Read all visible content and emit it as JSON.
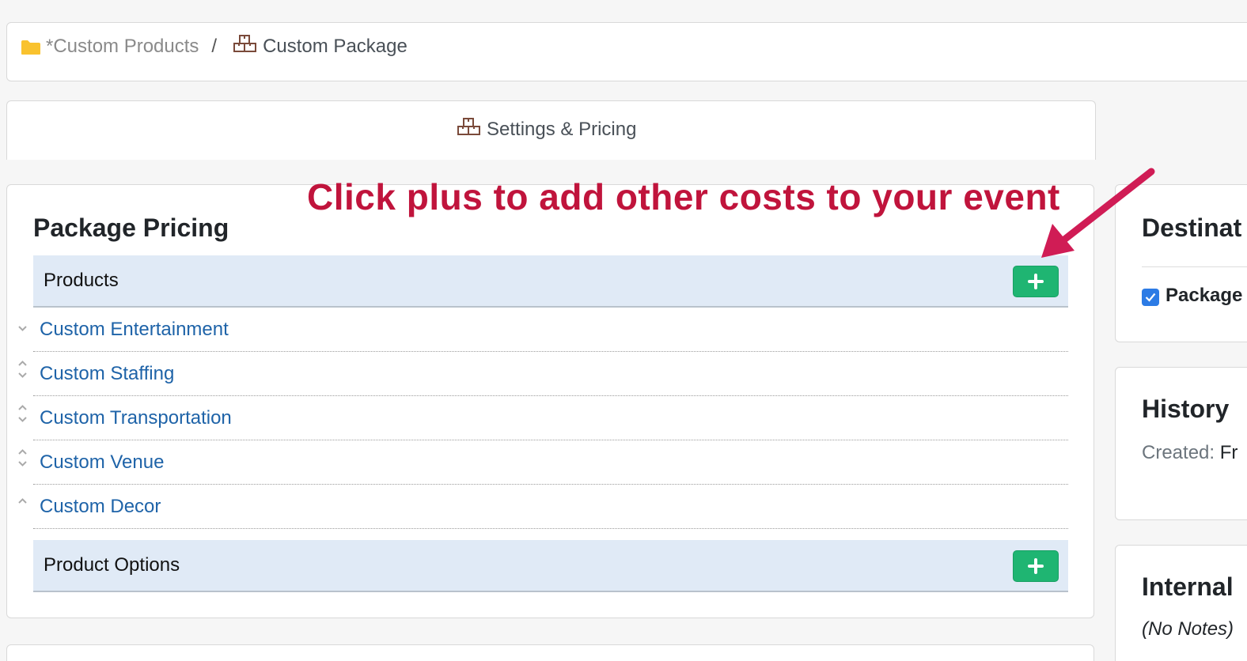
{
  "breadcrumb": {
    "parent": "*Custom Products",
    "separator": "/",
    "current": "Custom Package",
    "parent_icon": "folder-icon",
    "current_icon": "boxes-icon",
    "folder_color": "#f9c22e"
  },
  "tabs": [
    {
      "label": "Settings & Pricing",
      "icon": "boxes-icon"
    }
  ],
  "annotation": {
    "text": "Click plus to add other costs to your event",
    "color": "#c0143c"
  },
  "package_pricing": {
    "title": "Package Pricing",
    "products_header": "Products",
    "products": [
      {
        "label": "Custom Entertainment"
      },
      {
        "label": "Custom Staffing"
      },
      {
        "label": "Custom Transportation"
      },
      {
        "label": "Custom Venue"
      },
      {
        "label": "Custom Decor"
      }
    ],
    "options_header": "Product Options",
    "add_button_color": "#1fb572"
  },
  "sidebar": {
    "destination": {
      "title": "Destinat",
      "checkbox_label": "Package",
      "checked": true
    },
    "history": {
      "title": "History",
      "created_label": "Created:",
      "created_value": "Fr"
    },
    "notes": {
      "title": "Internal",
      "empty_text": "(No Notes)"
    }
  }
}
